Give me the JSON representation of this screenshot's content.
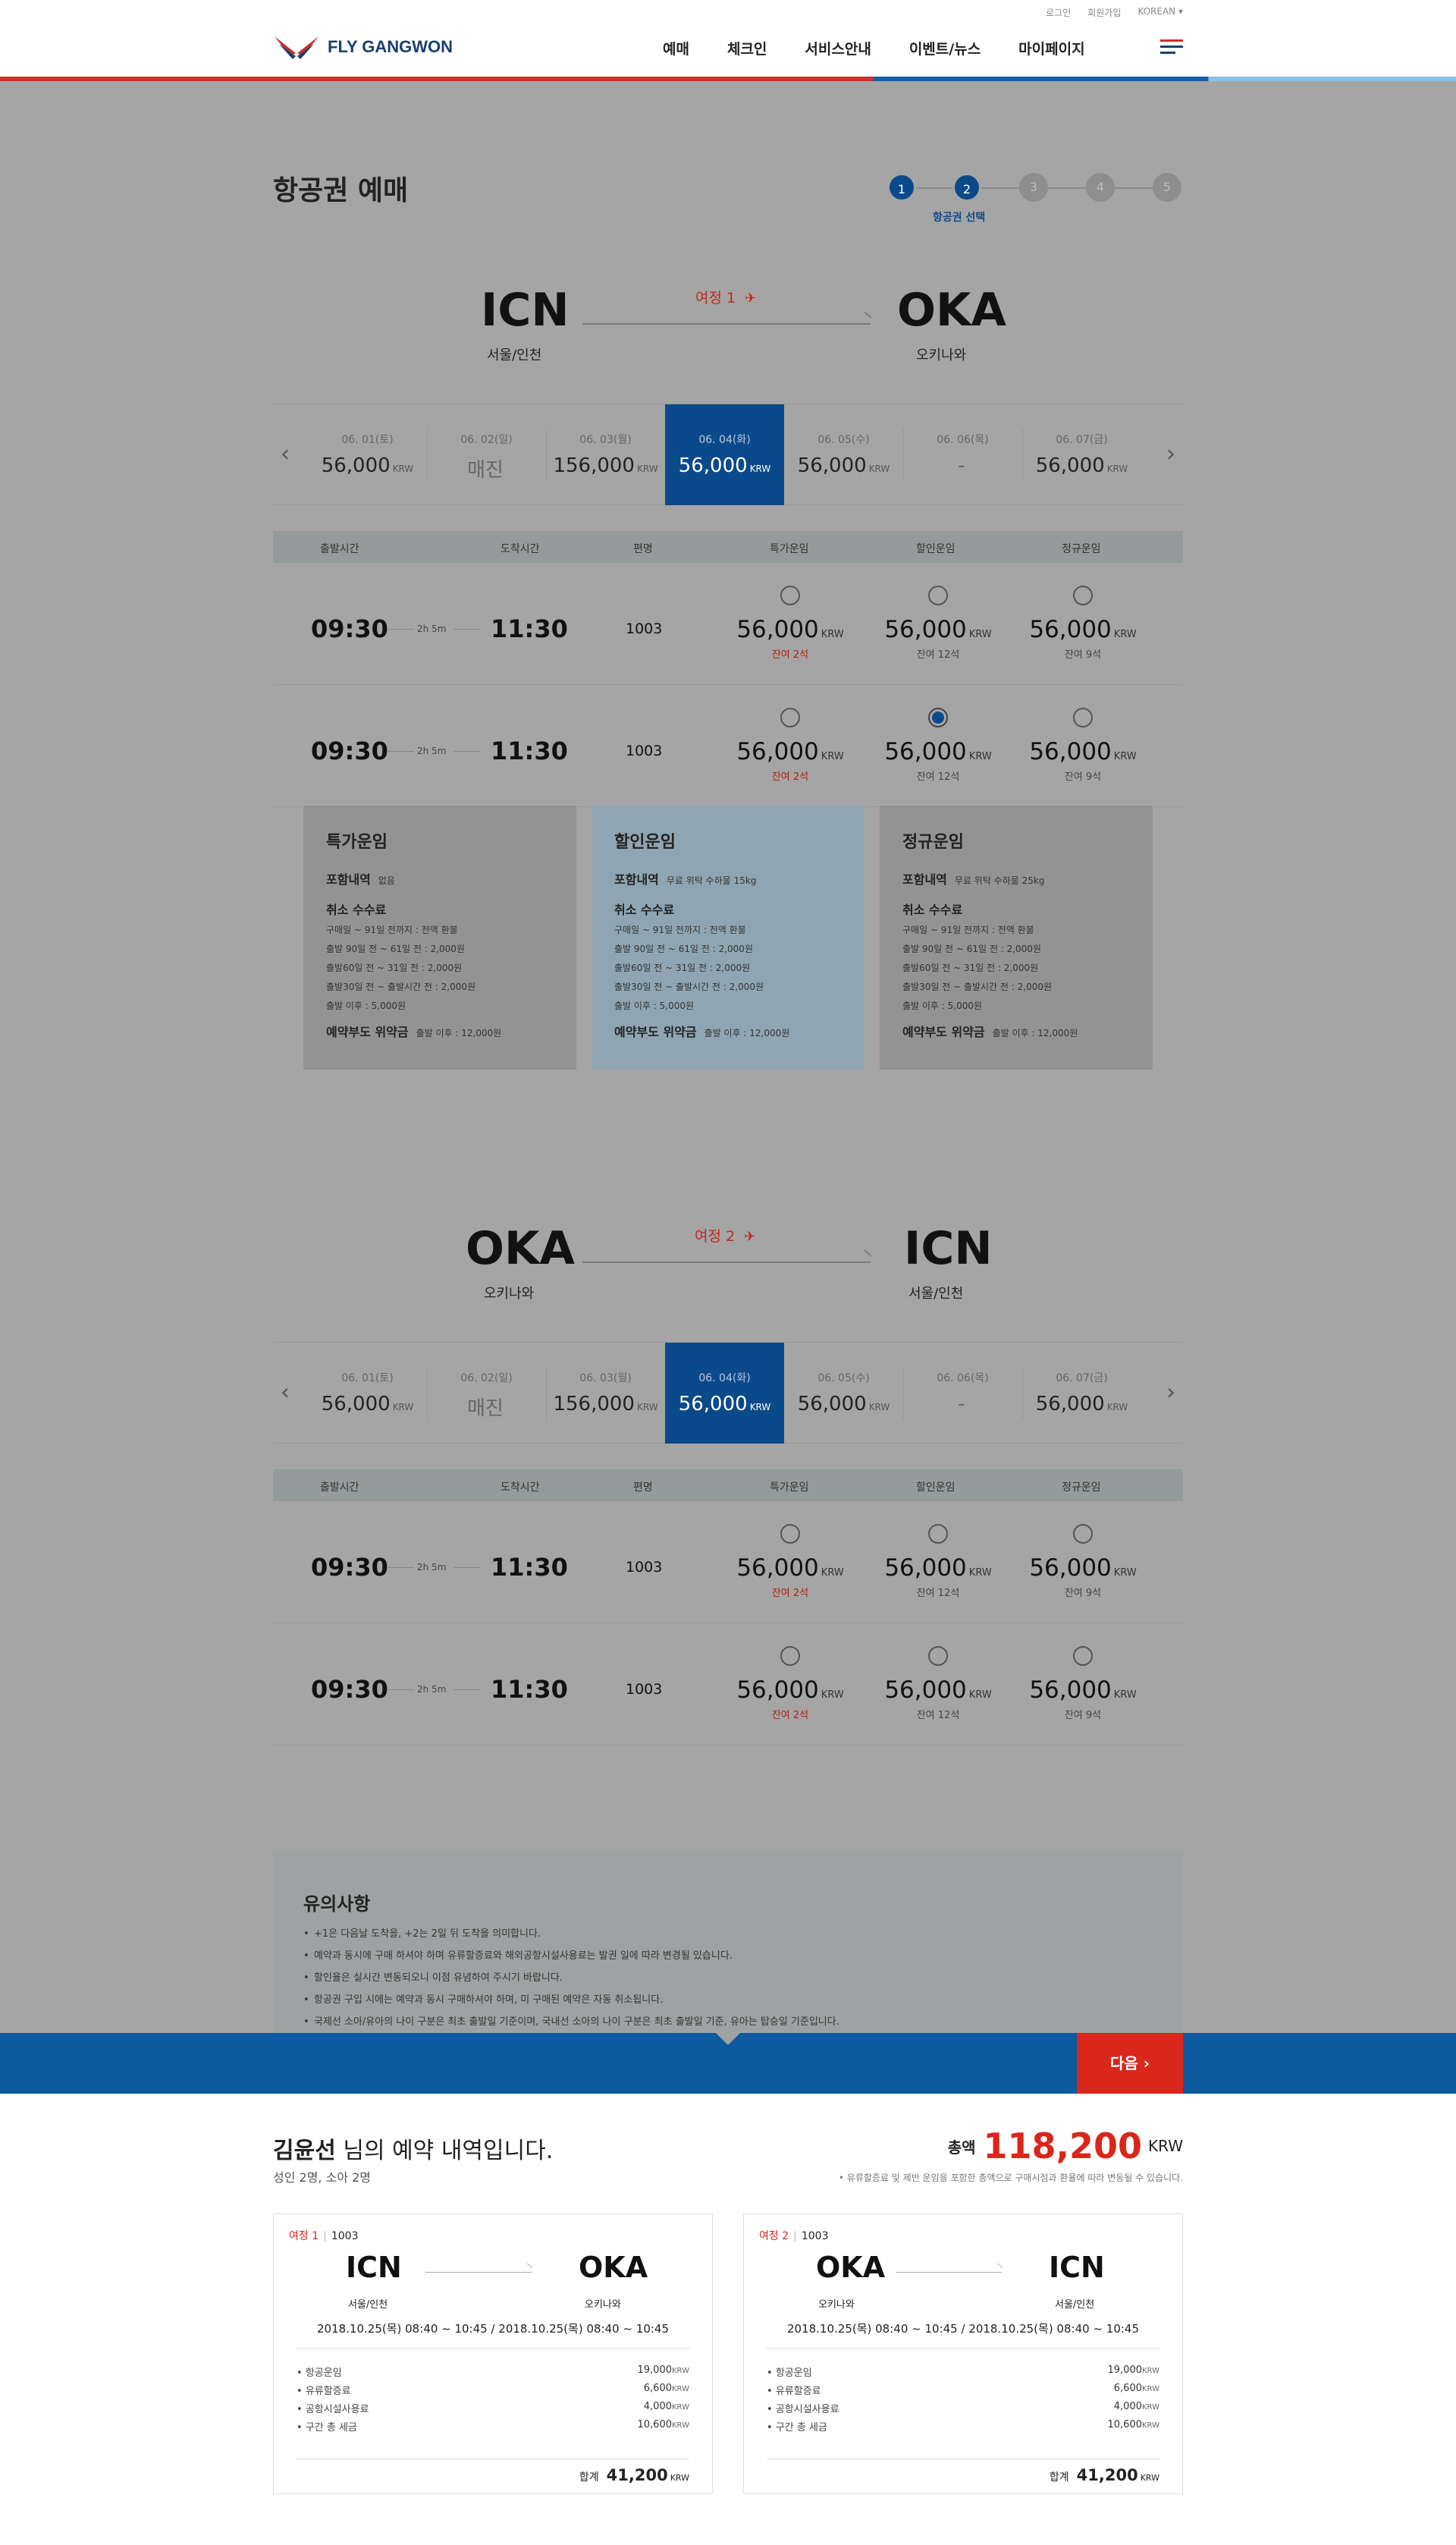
{
  "header": {
    "util": [
      "로그인",
      "회원가입",
      "KOREAN ▾"
    ],
    "logo_text": "FLY GANGWON",
    "nav": [
      "예매",
      "체크인",
      "서비스안내",
      "이벤트/뉴스",
      "마이페이지"
    ]
  },
  "page_title": "항공권 예매",
  "steps": {
    "items": [
      "1",
      "2",
      "3",
      "4",
      "5"
    ],
    "current": 2,
    "caption": "항공권 선택"
  },
  "journeys": [
    {
      "leg_label": "여정 1",
      "from_code": "ICN",
      "from_city": "서울/인천",
      "to_code": "OKA",
      "to_city": "오키나와",
      "dates": [
        {
          "date": "06. 01(토)",
          "price": "56,000",
          "unit": "KRW"
        },
        {
          "date": "06. 02(일)",
          "price": "매진",
          "unit": ""
        },
        {
          "date": "06. 03(월)",
          "price": "156,000",
          "unit": "KRW"
        },
        {
          "date": "06. 04(화)",
          "price": "56,000",
          "unit": "KRW"
        },
        {
          "date": "06. 05(수)",
          "price": "56,000",
          "unit": "KRW"
        },
        {
          "date": "06. 06(목)",
          "price": "-",
          "unit": ""
        },
        {
          "date": "06. 07(금)",
          "price": "56,000",
          "unit": "KRW"
        }
      ],
      "selected_date_index": 3,
      "flights": [
        {
          "dep": "09:30",
          "dur": "2h 5m",
          "arr": "11:30",
          "no": "1003",
          "fares": [
            {
              "price": "56,000",
              "unit": "KRW",
              "seats": "잔여 2석",
              "selected": false
            },
            {
              "price": "56,000",
              "unit": "KRW",
              "seats": "잔여 12석",
              "selected": false
            },
            {
              "price": "56,000",
              "unit": "KRW",
              "seats": "잔여 9석",
              "selected": false
            }
          ]
        },
        {
          "dep": "09:30",
          "dur": "2h 5m",
          "arr": "11:30",
          "no": "1003",
          "fares": [
            {
              "price": "56,000",
              "unit": "KRW",
              "seats": "잔여 2석",
              "selected": false
            },
            {
              "price": "56,000",
              "unit": "KRW",
              "seats": "잔여 12석",
              "selected": true
            },
            {
              "price": "56,000",
              "unit": "KRW",
              "seats": "잔여 9석",
              "selected": false
            }
          ]
        }
      ]
    },
    {
      "leg_label": "여정 2",
      "from_code": "OKA",
      "from_city": "오키나와",
      "to_code": "ICN",
      "to_city": "서울/인천",
      "dates": [
        {
          "date": "06. 01(토)",
          "price": "56,000",
          "unit": "KRW"
        },
        {
          "date": "06. 02(일)",
          "price": "매진",
          "unit": ""
        },
        {
          "date": "06. 03(월)",
          "price": "156,000",
          "unit": "KRW"
        },
        {
          "date": "06. 04(화)",
          "price": "56,000",
          "unit": "KRW"
        },
        {
          "date": "06. 05(수)",
          "price": "56,000",
          "unit": "KRW"
        },
        {
          "date": "06. 06(목)",
          "price": "-",
          "unit": ""
        },
        {
          "date": "06. 07(금)",
          "price": "56,000",
          "unit": "KRW"
        }
      ],
      "selected_date_index": 3,
      "flights": [
        {
          "dep": "09:30",
          "dur": "2h 5m",
          "arr": "11:30",
          "no": "1003",
          "fares": [
            {
              "price": "56,000",
              "unit": "KRW",
              "seats": "잔여 2석",
              "selected": false
            },
            {
              "price": "56,000",
              "unit": "KRW",
              "seats": "잔여 12석",
              "selected": false
            },
            {
              "price": "56,000",
              "unit": "KRW",
              "seats": "잔여 9석",
              "selected": false
            }
          ]
        },
        {
          "dep": "09:30",
          "dur": "2h 5m",
          "arr": "11:30",
          "no": "1003",
          "fares": [
            {
              "price": "56,000",
              "unit": "KRW",
              "seats": "잔여 2석",
              "selected": false
            },
            {
              "price": "56,000",
              "unit": "KRW",
              "seats": "잔여 12석",
              "selected": false
            },
            {
              "price": "56,000",
              "unit": "KRW",
              "seats": "잔여 9석",
              "selected": false
            }
          ]
        }
      ]
    }
  ],
  "table_headers": [
    "출발시간",
    "도착시간",
    "편명",
    "특가운임",
    "할인운임",
    "정규운임"
  ],
  "fare_info": [
    {
      "title": "특가운임",
      "incl_label": "포함내역",
      "incl": "없음",
      "cancel_label": "취소 수수료",
      "lines": [
        "구매일 ~ 91일 전까지 : 전액 환불",
        "출발 90일 전 ~ 61일 전 : 2,000원",
        "출발60일 전 ~ 31일 전 : 2,000원",
        "출발30일 전 ~ 출발시간 전 : 2,000원",
        "출발 이후 : 5,000원"
      ],
      "noshow_label": "예약부도 위약금",
      "noshow": "출발 이후 : 12,000원"
    },
    {
      "title": "할인운임",
      "incl_label": "포함내역",
      "incl": "무료 위탁 수하물 15kg",
      "cancel_label": "취소 수수료",
      "lines": [
        "구매일 ~ 91일 전까지 : 전액 환불",
        "출발 90일 전 ~ 61일 전 : 2,000원",
        "출발60일 전 ~ 31일 전 : 2,000원",
        "출발30일 전 ~ 출발시간 전 : 2,000원",
        "출발 이후 : 5,000원"
      ],
      "noshow_label": "예약부도 위약금",
      "noshow": "출발 이후 : 12,000원"
    },
    {
      "title": "정규운임",
      "incl_label": "포함내역",
      "incl": "무료 위탁 수하물 25kg",
      "cancel_label": "취소 수수료",
      "lines": [
        "구매일 ~ 91일 전까지 : 전액 환불",
        "출발 90일 전 ~ 61일 전 : 2,000원",
        "출발60일 전 ~ 31일 전 : 2,000원",
        "출발30일 전 ~ 출발시간 전 : 2,000원",
        "출발 이후 : 5,000원"
      ],
      "noshow_label": "예약부도 위약금",
      "noshow": "출발 이후 : 12,000원"
    }
  ],
  "notice": {
    "title": "유의사항",
    "items": [
      "+1은 다음날 도착을, +2는 2일 뒤 도착을 의미합니다.",
      "예약과 동시에 구매 하셔야 하며 유류할증료와 해외공항시설사용료는 발권 일에 따라 변경될 있습니다.",
      "할인율은 실시간 변동되오니 이점 유념하여 주시기 바랍니다.",
      "항공권 구입 시에는 예약과 동시 구매하셔야 하며, 미 구매된 예약은 자동 취소됩니다.",
      "국제선 소아/유아의 나이 구분은 최초 출발일 기준이며, 국내선 소아의 나이 구분은 최초 출발일 기준, 유아는 탑승일 기준입니다."
    ]
  },
  "next_label": "다음 ›",
  "summary": {
    "name": "김윤선",
    "suffix": " 님의 예약 내역입니다.",
    "pax": "성인 2명, 소아 2명",
    "total_label": "총액",
    "total": "118,200",
    "currency": "KRW",
    "note": "• 유류할증료 및 제반 운임을 포함한 총액으로  구매시점과 환율에 따라 변동될 수 있습니다.",
    "cards": [
      {
        "leg": "여정 1",
        "flight": "1003",
        "from_code": "ICN",
        "from_city": "서울/인천",
        "to_code": "OKA",
        "to_city": "오키나와",
        "datetime": "2018.10.25(목) 08:40 ~ 10:45  /  2018.10.25(목) 08:40 ~ 10:45",
        "fees": [
          {
            "label": "항공운임",
            "value": "19,000"
          },
          {
            "label": "유류할증료",
            "value": "6,600"
          },
          {
            "label": "공항시설사용료",
            "value": "4,000"
          },
          {
            "label": "구간 총 세금",
            "value": "10,600"
          }
        ],
        "fee_unit": "KRW",
        "total_label": "합계",
        "total": "41,200",
        "total_unit": "KRW"
      },
      {
        "leg": "여정 2",
        "flight": "1003",
        "from_code": "OKA",
        "from_city": "오키나와",
        "to_code": "ICN",
        "to_city": "서울/인천",
        "datetime": "2018.10.25(목) 08:40 ~ 10:45  /  2018.10.25(목) 08:40 ~ 10:45",
        "fees": [
          {
            "label": "항공운임",
            "value": "19,000"
          },
          {
            "label": "유류할증료",
            "value": "6,600"
          },
          {
            "label": "공항시설사용료",
            "value": "4,000"
          },
          {
            "label": "구간 총 세금",
            "value": "10,600"
          }
        ],
        "fee_unit": "KRW",
        "total_label": "합계",
        "total": "41,200",
        "total_unit": "KRW"
      }
    ]
  },
  "colors": {
    "brand_blue": "#0b4a8a",
    "accent_red": "#d9271b",
    "overlay": "#a5a5a5"
  }
}
